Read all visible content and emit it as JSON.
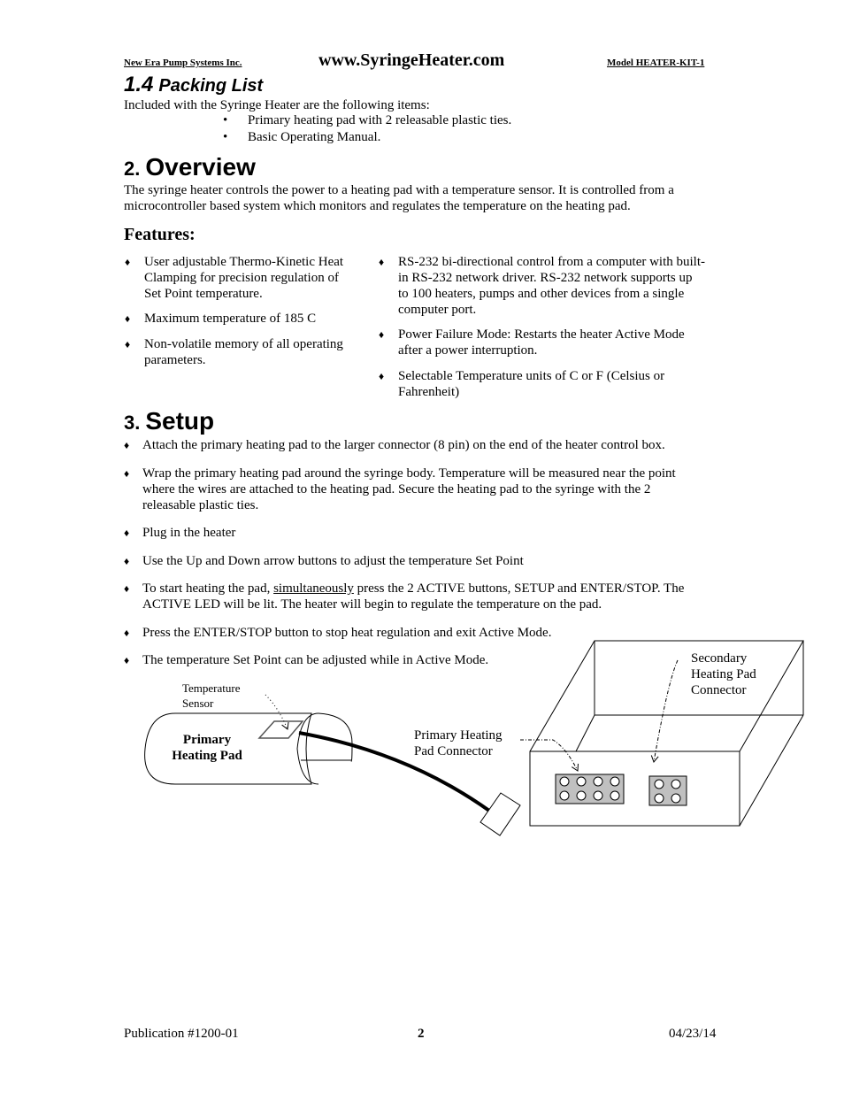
{
  "header": {
    "company": "New Era Pump Systems Inc.",
    "website": "www.SyringeHeater.com",
    "model": "Model HEATER-KIT-1"
  },
  "packing_list": {
    "number": "1.4",
    "title": "Packing List",
    "intro": "Included with the Syringe Heater are the following items:",
    "bullet": "•",
    "items": [
      "Primary heating pad with 2 releasable plastic ties.",
      "Basic Operating Manual."
    ]
  },
  "overview": {
    "number": "2.",
    "title": "Overview",
    "paragraph": [
      "The syringe heater controls the power to a heating pad with a temperature sensor.  It is controlled from a",
      "microcontroller based system which monitors and regulates the temperature on the heating pad."
    ],
    "features_heading": "Features:",
    "bullet": "♦",
    "features_left": [
      [
        "User adjustable Thermo-Kinetic Heat",
        "Clamping for precision regulation of",
        "Set Point temperature."
      ],
      [
        "Maximum temperature of 185 C"
      ],
      [
        "Non-volatile memory of all operating",
        "parameters."
      ]
    ],
    "features_right": [
      [
        "RS-232 bi-directional control from a computer with built-",
        "in RS-232 network driver.  RS-232 network supports up",
        "to 100 heaters, pumps and other devices from a single",
        "computer port."
      ],
      [
        "Power Failure Mode:  Restarts the heater Active Mode",
        "after a power interruption."
      ],
      [
        "Selectable Temperature units of C or F (Celsius or",
        "Fahrenheit)"
      ]
    ]
  },
  "setup": {
    "number": "3.",
    "title": "Setup",
    "bullet": "♦",
    "items": [
      [
        "Attach the primary heating pad to the larger connector (8 pin) on the end of the heater control box."
      ],
      [
        "Wrap the primary heating pad around the syringe body.  Temperature will be measured near the point",
        "where the wires are attached to the heating pad.  Secure the heating pad to the syringe with the 2",
        "releasable plastic ties."
      ],
      [
        "Plug in the heater"
      ],
      [
        "Use the Up and Down arrow buttons to adjust the temperature Set Point"
      ],
      {
        "pre": "To start heating the pad, ",
        "underlined": "simultaneously",
        "post": " press the 2 ACTIVE buttons, SETUP and ENTER/STOP.  The",
        "line2": "ACTIVE LED will be lit.  The heater will begin to regulate the temperature on the pad."
      },
      [
        "Press the ENTER/STOP button to stop heat regulation and exit Active Mode."
      ],
      [
        "The temperature Set Point can be adjusted while in Active Mode."
      ]
    ]
  },
  "diagram": {
    "temp_sensor_label": [
      "Temperature",
      "Sensor"
    ],
    "pad_label": [
      "Primary",
      "Heating Pad"
    ],
    "primary_connector_label": [
      "Primary Heating",
      "Pad Connector"
    ],
    "secondary_connector_label": [
      "Secondary",
      "Heating Pad",
      "Connector"
    ],
    "primary_connector_pins": 8,
    "secondary_connector_pins": 4,
    "connector_fill": "#c0c0c0"
  },
  "footer": {
    "publication": "Publication #1200-01",
    "page": "2",
    "date": "04/23/14"
  }
}
